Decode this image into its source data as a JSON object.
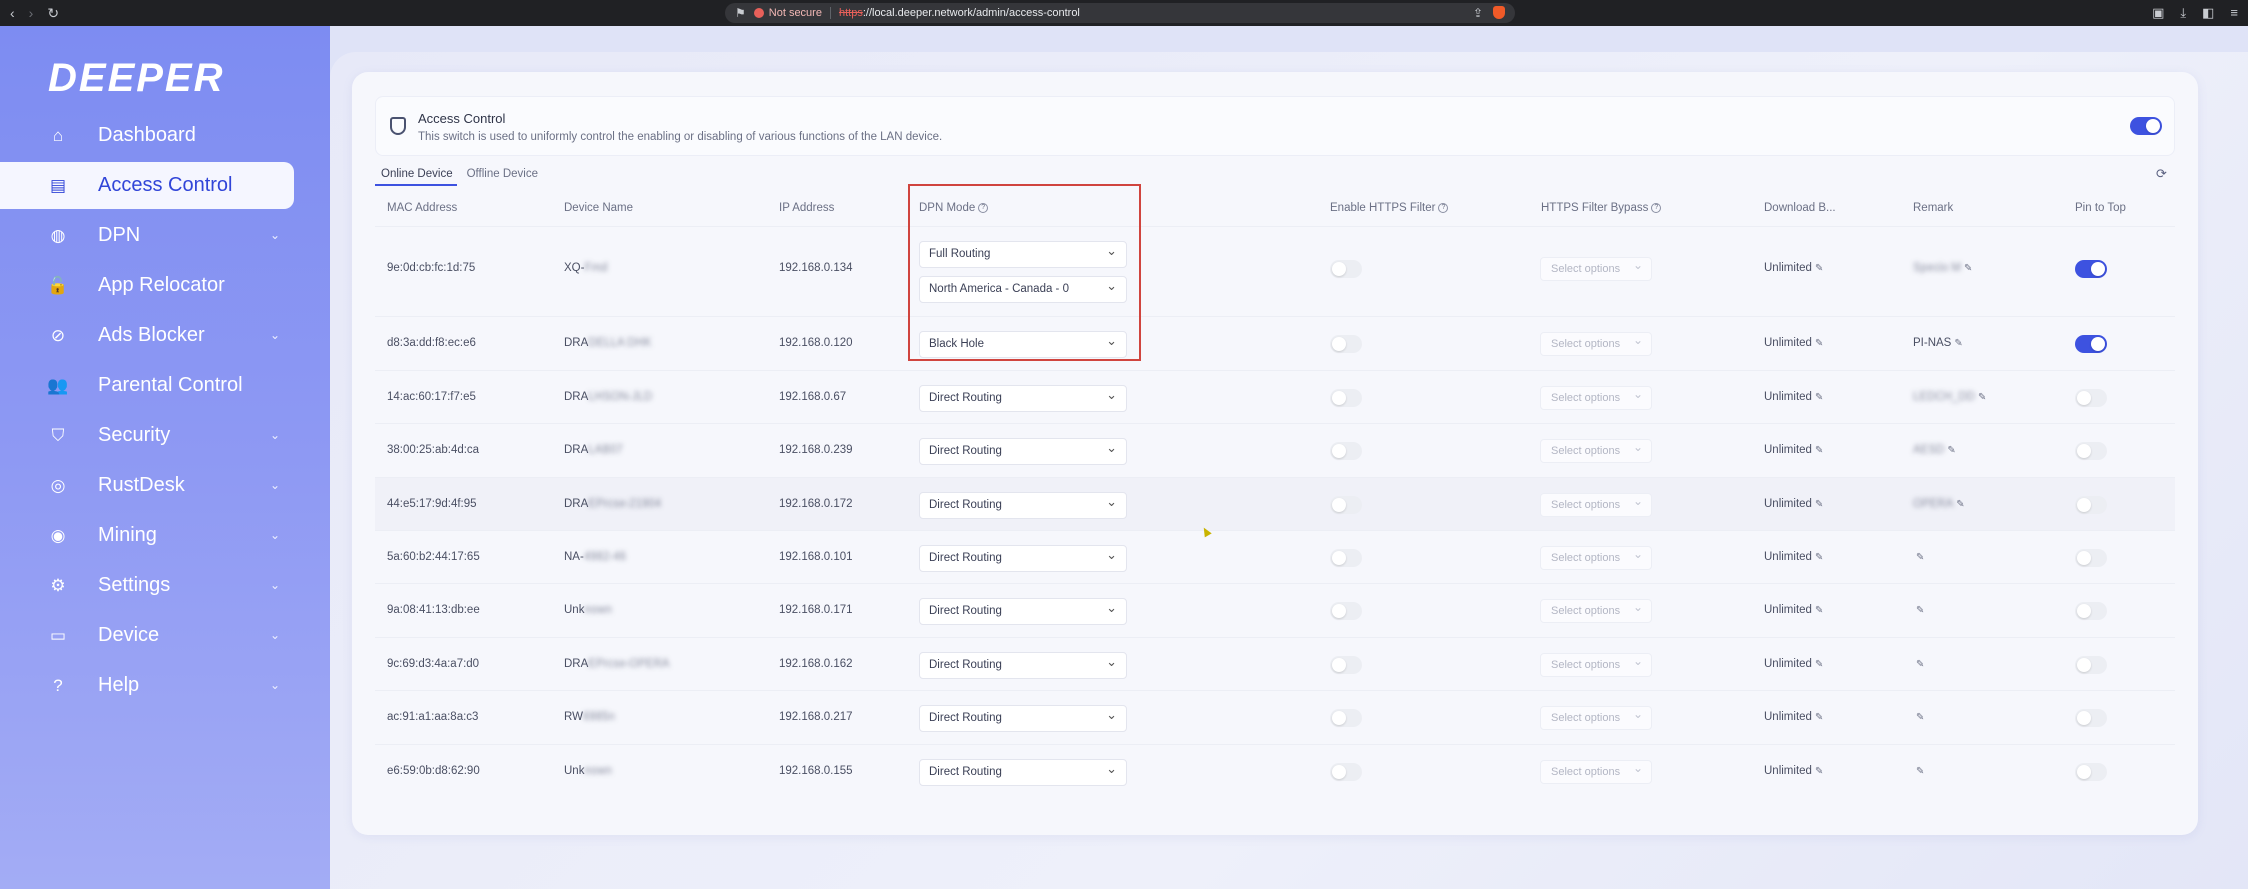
{
  "browser": {
    "not_secure": "Not secure",
    "url_scheme": "https",
    "url_rest": "://local.deeper.network/admin/access-control"
  },
  "sidebar": {
    "logo": "DEEPER",
    "items": [
      {
        "label": "Dashboard",
        "icon": "home-icon",
        "active": false,
        "expandable": false
      },
      {
        "label": "Access Control",
        "icon": "access-control-icon",
        "active": true,
        "expandable": false
      },
      {
        "label": "DPN",
        "icon": "globe-icon",
        "active": false,
        "expandable": true
      },
      {
        "label": "App Relocator",
        "icon": "lock-icon",
        "active": false,
        "expandable": false
      },
      {
        "label": "Ads Blocker",
        "icon": "block-icon",
        "active": false,
        "expandable": true
      },
      {
        "label": "Parental Control",
        "icon": "family-icon",
        "active": false,
        "expandable": false
      },
      {
        "label": "Security",
        "icon": "shield-icon",
        "active": false,
        "expandable": true
      },
      {
        "label": "RustDesk",
        "icon": "remote-desktop-icon",
        "active": false,
        "expandable": true
      },
      {
        "label": "Mining",
        "icon": "coin-icon",
        "active": false,
        "expandable": true
      },
      {
        "label": "Settings",
        "icon": "gear-icon",
        "active": false,
        "expandable": true
      },
      {
        "label": "Device",
        "icon": "device-icon",
        "active": false,
        "expandable": true
      },
      {
        "label": "Help",
        "icon": "help-icon",
        "active": false,
        "expandable": true
      }
    ]
  },
  "access_control": {
    "title": "Access Control",
    "description": "This switch is used to uniformly control the enabling or disabling of various functions of the LAN device.",
    "enabled": true
  },
  "tabs": [
    "Online Device",
    "Offline Device"
  ],
  "columns": {
    "mac": "MAC Address",
    "device": "Device Name",
    "ip": "IP Address",
    "dpn": "DPN Mode",
    "https": "Enable HTTPS Filter",
    "bypass": "HTTPS Filter Bypass",
    "download": "Download B...",
    "remark": "Remark",
    "pin": "Pin to Top"
  },
  "select_placeholder": "Select options",
  "rows": [
    {
      "mac": "9e:0d:cb:fc:1d:75",
      "device_visible": "XQ-",
      "device_blurred": "Fmd",
      "ip": "192.168.0.134",
      "dpn": "Full Routing",
      "dpn_region": "North America - Canada - 0",
      "download": "Unlimited",
      "remark_visible": "",
      "remark_blurred": "Specio M",
      "pinned": true
    },
    {
      "mac": "d8:3a:dd:f8:ec:e6",
      "device_visible": "DRA",
      "device_blurred": "DELLA DHK",
      "ip": "192.168.0.120",
      "dpn": "Black Hole",
      "download": "Unlimited",
      "remark_visible": "PI-NAS",
      "remark_blurred": "",
      "pinned": true
    },
    {
      "mac": "14:ac:60:17:f7:e5",
      "device_visible": "DRA",
      "device_blurred": "LHSON-JLD",
      "ip": "192.168.0.67",
      "dpn": "Direct Routing",
      "download": "Unlimited",
      "remark_visible": "",
      "remark_blurred": "LEDCH_DD",
      "pinned": false
    },
    {
      "mac": "38:00:25:ab:4d:ca",
      "device_visible": "DRA",
      "device_blurred": "LAB07",
      "ip": "192.168.0.239",
      "dpn": "Direct Routing",
      "download": "Unlimited",
      "remark_visible": "",
      "remark_blurred": "AESD",
      "pinned": false
    },
    {
      "mac": "44:e5:17:9d:4f:95",
      "device_visible": "DRA",
      "device_blurred": "EPrcse-21904",
      "ip": "192.168.0.172",
      "dpn": "Direct Routing",
      "download": "Unlimited",
      "remark_visible": "",
      "remark_blurred": "OPERA",
      "pinned": false
    },
    {
      "mac": "5a:60:b2:44:17:65",
      "device_visible": "NA-",
      "device_blurred": "4982-46",
      "ip": "192.168.0.101",
      "dpn": "Direct Routing",
      "download": "Unlimited",
      "remark_visible": "",
      "remark_blurred": "",
      "pinned": false
    },
    {
      "mac": "9a:08:41:13:db:ee",
      "device_visible": "Unk",
      "device_blurred": "nown",
      "ip": "192.168.0.171",
      "dpn": "Direct Routing",
      "download": "Unlimited",
      "remark_visible": "",
      "remark_blurred": "",
      "pinned": false
    },
    {
      "mac": "9c:69:d3:4a:a7:d0",
      "device_visible": "DRA",
      "device_blurred": "EPrcse-OPERA",
      "ip": "192.168.0.162",
      "dpn": "Direct Routing",
      "download": "Unlimited",
      "remark_visible": "",
      "remark_blurred": "",
      "pinned": false
    },
    {
      "mac": "ac:91:a1:aa:8a:c3",
      "device_visible": "RW",
      "device_blurred": "6985n",
      "ip": "192.168.0.217",
      "dpn": "Direct Routing",
      "download": "Unlimited",
      "remark_visible": "",
      "remark_blurred": "",
      "pinned": false
    },
    {
      "mac": "e6:59:0b:d8:62:90",
      "device_visible": "Unk",
      "device_blurred": "nown",
      "ip": "192.168.0.155",
      "dpn": "Direct Routing",
      "download": "Unlimited",
      "remark_visible": "",
      "remark_blurred": "",
      "pinned": false
    }
  ],
  "colors": {
    "accent": "#3d52e0",
    "sidebar": "#8b97f3",
    "highlight_border": "#d0443e"
  }
}
